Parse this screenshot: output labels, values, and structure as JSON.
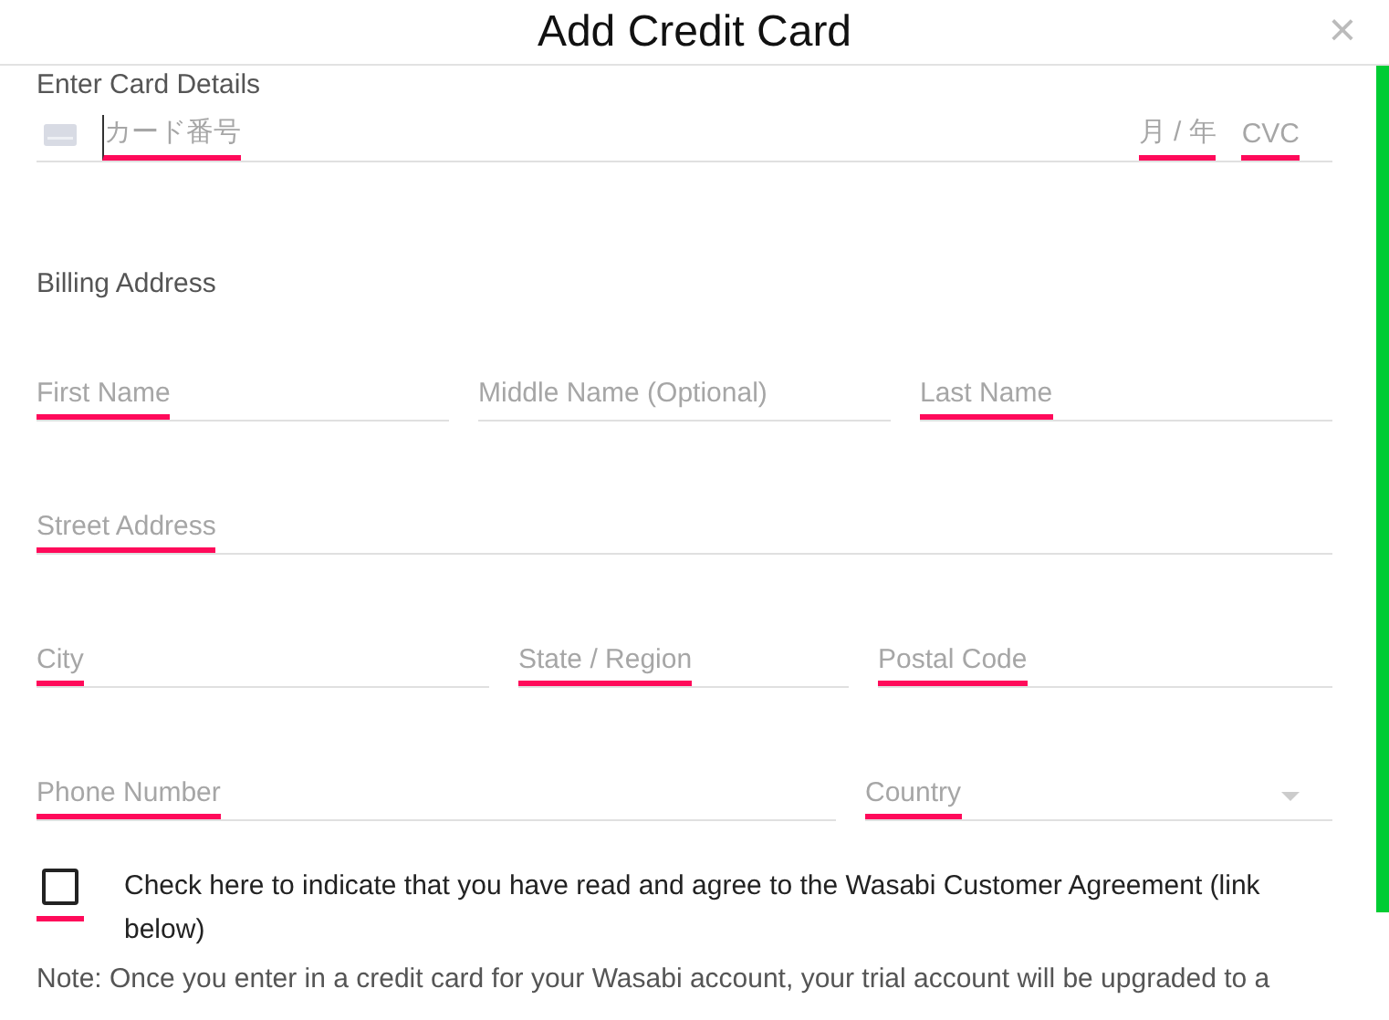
{
  "dialog": {
    "title": "Add Credit Card",
    "close": "×"
  },
  "card_section": {
    "heading": "Enter Card Details",
    "fields": [
      {
        "kind": "number",
        "placeholder": "カード番号",
        "error": true
      },
      {
        "kind": "expiry",
        "placeholder": "月 / 年",
        "error": true
      },
      {
        "kind": "cvc",
        "placeholder": "CVC",
        "error": true
      }
    ]
  },
  "billing": {
    "heading": "Billing Address",
    "rows": [
      [
        {
          "placeholder": "First Name",
          "error": true,
          "kind": "text"
        },
        {
          "placeholder": "Middle Name (Optional)",
          "error": false,
          "kind": "text"
        },
        {
          "placeholder": "Last Name",
          "error": true,
          "kind": "text"
        }
      ],
      [
        {
          "placeholder": "Street Address",
          "error": true,
          "kind": "text"
        }
      ],
      [
        {
          "placeholder": "City",
          "error": true,
          "kind": "text"
        },
        {
          "placeholder": "State / Region",
          "error": true,
          "kind": "text"
        },
        {
          "placeholder": "Postal Code",
          "error": true,
          "kind": "text"
        }
      ],
      [
        {
          "placeholder": "Phone Number",
          "error": true,
          "kind": "text"
        },
        {
          "placeholder": "Country",
          "error": true,
          "kind": "select"
        }
      ]
    ]
  },
  "agreement": {
    "checked": false,
    "error": true,
    "label": "Check here to indicate that you have read and agree to the Wasabi Customer Agreement (link below)"
  },
  "note": "Note: Once you enter in a credit card for your Wasabi account, your trial account will be upgraded to a"
}
